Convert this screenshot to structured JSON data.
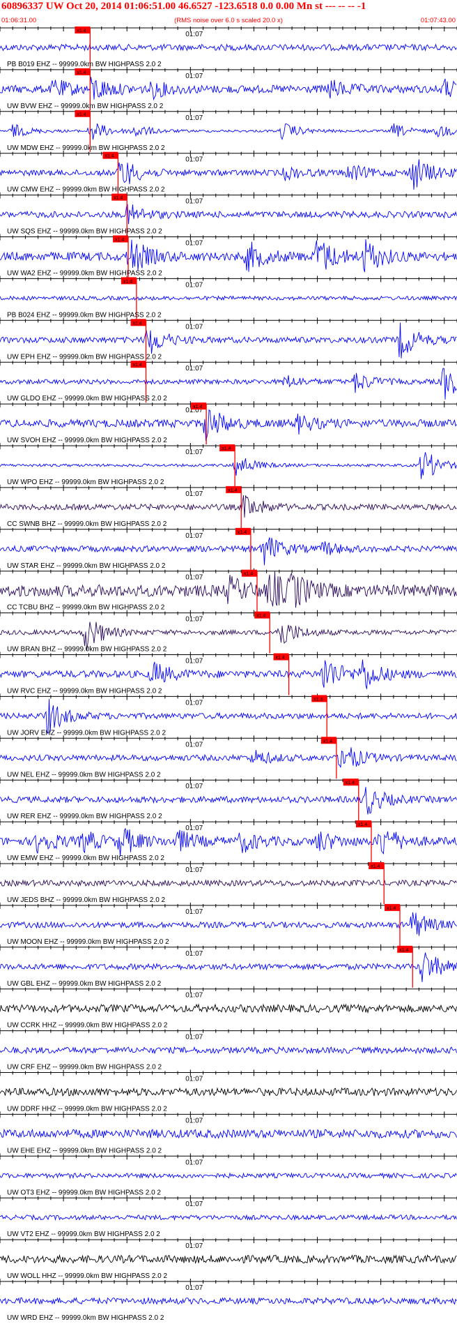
{
  "header": {
    "title": "60896337 UW Oct 20, 2014 01:06:51.00   46.6527 -123.6518  0.0 0.00 Mn st --- -- --   -1",
    "start_time": "01:06:31.00",
    "rms_note": "(RMS noise over 6.0 s scaled 20.0 x)",
    "end_time": "01:07:43.00"
  },
  "chart_data": {
    "type": "line",
    "title": "60896337 UW Oct 20, 2014 01:06:51.00   46.6527 -123.6518  0.0 0.00 Mn st --- -- --   -1",
    "x_range_seconds": [
      0,
      72
    ],
    "x_start_label": "01:06:31.00",
    "x_end_label": "01:07:43.00",
    "minute_mark_label": "01:07",
    "minute_mark_seconds": 29,
    "pick_label": "x1.4",
    "colors": {
      "trace_ehz": "#0000ff",
      "trace_bhz": "#2a0a5a",
      "trace_hhz": "#000000",
      "pick": "#ff0000",
      "axis": "#000000"
    },
    "traces": [
      {
        "label": "PB B019 EHZ -- 99999.0km BW  HIGHPASS  2.0  2",
        "pick_s": 14.2,
        "noise": 0.16,
        "events": [],
        "color": "#0000ff"
      },
      {
        "label": "UW BVW EHZ -- 99999.0km BW  HIGHPASS  2.0  2",
        "pick_s": 14.2,
        "noise": 0.2,
        "events": [
          [
            8.5,
            0.45
          ],
          [
            14.5,
            0.6
          ],
          [
            24,
            0.35
          ],
          [
            52,
            0.4
          ],
          [
            70,
            0.4
          ]
        ],
        "color": "#0000ff"
      },
      {
        "label": "UW MDW EHZ -- 99999.0km BW  HIGHPASS  2.0  2",
        "pick_s": 14.2,
        "noise": 0.06,
        "events": [
          [
            2,
            0.35
          ],
          [
            14.3,
            0.55
          ],
          [
            21,
            0.35
          ],
          [
            44.5,
            0.45
          ],
          [
            62,
            0.35
          ],
          [
            69,
            0.3
          ]
        ],
        "color": "#0000ff"
      },
      {
        "label": "UW CMW EHZ -- 99999.0km BW  HIGHPASS  2.0  2",
        "pick_s": 18.6,
        "noise": 0.15,
        "events": [
          [
            19,
            0.8
          ],
          [
            45,
            0.3
          ],
          [
            55,
            0.4
          ],
          [
            65,
            0.9
          ]
        ],
        "color": "#0000ff"
      },
      {
        "label": "UW SQS EHZ -- 99999.0km BW  HIGHPASS  2.0  2",
        "pick_s": 20.0,
        "noise": 0.16,
        "events": [
          [
            20.2,
            0.5
          ]
        ],
        "color": "#0000ff"
      },
      {
        "label": "UW WA2 EHZ -- 99999.0km BW  HIGHPASS  2.0  2",
        "pick_s": 20.2,
        "noise": 0.22,
        "events": [
          [
            20.5,
            0.9
          ],
          [
            39,
            0.7
          ],
          [
            50,
            0.95
          ],
          [
            57.5,
            0.8
          ]
        ],
        "color": "#0000ff"
      },
      {
        "label": "PB B024 EHZ -- 99999.0km BW  HIGHPASS  2.0  2",
        "pick_s": 21.5,
        "noise": 0.1,
        "events": [],
        "color": "#0000ff"
      },
      {
        "label": "UW EPH EHZ -- 99999.0km BW  HIGHPASS  2.0  2",
        "pick_s": 23.0,
        "noise": 0.15,
        "events": [
          [
            23.2,
            0.8
          ],
          [
            63,
            0.9
          ]
        ],
        "color": "#0000ff"
      },
      {
        "label": "UW GLDO EHZ -- 99999.0km BW  HIGHPASS  2.0  2",
        "pick_s": 23.0,
        "noise": 0.12,
        "events": [
          [
            45,
            0.3
          ],
          [
            56,
            0.5
          ],
          [
            70,
            0.9
          ]
        ],
        "color": "#0000ff"
      },
      {
        "label": "UW SVOH EHZ -- 99999.0km BW  HIGHPASS  2.0  2",
        "pick_s": 32.5,
        "noise": 0.2,
        "events": [
          [
            32.5,
            0.85
          ],
          [
            47,
            0.4
          ]
        ],
        "color": "#0000ff"
      },
      {
        "label": "UW WPO EHZ -- 99999.0km BW  HIGHPASS  2.0  2",
        "pick_s": 37.0,
        "noise": 0.07,
        "events": [
          [
            37.2,
            0.6
          ],
          [
            66.5,
            0.9
          ]
        ],
        "color": "#0000ff"
      },
      {
        "label": "CC SWNB BHZ -- 99999.0km BW  HIGHPASS  2.0  2",
        "pick_s": 38.0,
        "noise": 0.15,
        "events": [
          [
            38.5,
            0.6
          ]
        ],
        "color": "#2a0a5a"
      },
      {
        "label": "UW STAR EHZ -- 99999.0km BW  HIGHPASS  2.0  2",
        "pick_s": 39.5,
        "noise": 0.15,
        "events": [
          [
            41.5,
            0.8
          ],
          [
            51,
            0.3
          ]
        ],
        "color": "#0000ff"
      },
      {
        "label": "CC TCBU BHZ -- 99999.0km BW  HIGHPASS  2.0  2",
        "pick_s": 40.5,
        "noise": 0.3,
        "events": [
          [
            36,
            0.6
          ],
          [
            42.5,
            0.95
          ],
          [
            46,
            0.7
          ]
        ],
        "color": "#2a0a5a"
      },
      {
        "label": "UW BRAN BHZ -- 99999.0km BW  HIGHPASS  2.0  2",
        "pick_s": 42.5,
        "noise": 0.12,
        "events": [
          [
            13.5,
            0.95
          ],
          [
            44,
            0.8
          ]
        ],
        "color": "#2a0a5a"
      },
      {
        "label": "UW RVC EHZ -- 99999.0km BW  HIGHPASS  2.0  2",
        "pick_s": 45.5,
        "noise": 0.18,
        "events": [
          [
            24,
            0.6
          ],
          [
            51,
            0.95
          ],
          [
            57,
            0.8
          ]
        ],
        "color": "#0000ff"
      },
      {
        "label": "UW JORV EHZ -- 99999.0km BW  HIGHPASS  2.0  2",
        "pick_s": 51.5,
        "noise": 0.15,
        "events": [
          [
            7.5,
            0.85
          ]
        ],
        "color": "#0000ff"
      },
      {
        "label": "UW NEL EHZ -- 99999.0km BW  HIGHPASS  2.0  2",
        "pick_s": 53.0,
        "noise": 0.15,
        "events": [
          [
            40,
            0.35
          ],
          [
            53.8,
            0.85
          ]
        ],
        "color": "#0000ff"
      },
      {
        "label": "UW RER EHZ -- 99999.0km BW  HIGHPASS  2.0  2",
        "pick_s": 56.5,
        "noise": 0.16,
        "events": [
          [
            57.5,
            0.8
          ]
        ],
        "color": "#0000ff"
      },
      {
        "label": "UW EMW EHZ -- 99999.0km BW  HIGHPASS  2.0  2",
        "pick_s": 58.5,
        "noise": 0.2,
        "events": [
          [
            6,
            0.6
          ],
          [
            13,
            0.5
          ],
          [
            19,
            0.7
          ],
          [
            28,
            0.5
          ],
          [
            38,
            0.5
          ],
          [
            50,
            0.5
          ],
          [
            60,
            0.8
          ]
        ],
        "color": "#0000ff"
      },
      {
        "label": "UW JEDS BHZ -- 99999.0km BW  HIGHPASS  2.0  2",
        "pick_s": 60.5,
        "noise": 0.15,
        "events": [],
        "color": "#2a0a5a"
      },
      {
        "label": "UW MOON EHZ -- 99999.0km BW  HIGHPASS  2.0  2",
        "pick_s": 63.0,
        "noise": 0.15,
        "events": [
          [
            65,
            0.7
          ]
        ],
        "color": "#0000ff"
      },
      {
        "label": "UW GBL EHZ -- 99999.0km BW  HIGHPASS  2.0  2",
        "pick_s": 65.0,
        "noise": 0.15,
        "events": [
          [
            66.5,
            0.9
          ]
        ],
        "color": "#0000ff"
      },
      {
        "label": "UW CCRK HHZ -- 99999.0km BW  HIGHPASS  2.0  2",
        "pick_s": null,
        "noise": 0.2,
        "events": [],
        "color": "#000000"
      },
      {
        "label": "UW CRF EHZ -- 99999.0km BW  HIGHPASS  2.0  2",
        "pick_s": null,
        "noise": 0.16,
        "events": [],
        "color": "#0000ff"
      },
      {
        "label": "UW DDRF HHZ -- 99999.0km BW  HIGHPASS  2.0  2",
        "pick_s": null,
        "noise": 0.2,
        "events": [],
        "color": "#000000"
      },
      {
        "label": "UW EHE EHZ -- 99999.0km BW  HIGHPASS  2.0  2",
        "pick_s": null,
        "noise": 0.22,
        "events": [],
        "color": "#0000ff"
      },
      {
        "label": "UW OT3 EHZ -- 99999.0km BW  HIGHPASS  2.0  2",
        "pick_s": null,
        "noise": 0.12,
        "events": [],
        "color": "#0000ff"
      },
      {
        "label": "UW VT2 EHZ -- 99999.0km BW  HIGHPASS  2.0  2",
        "pick_s": null,
        "noise": 0.12,
        "events": [],
        "color": "#0000ff"
      },
      {
        "label": "UW WOLL HHZ -- 99999.0km BW  HIGHPASS  2.0  2",
        "pick_s": null,
        "noise": 0.2,
        "events": [],
        "color": "#000000"
      },
      {
        "label": "UW WRD EHZ -- 99999.0km BW  HIGHPASS  2.0  2",
        "pick_s": null,
        "noise": 0.16,
        "events": [],
        "color": "#0000ff"
      }
    ]
  }
}
